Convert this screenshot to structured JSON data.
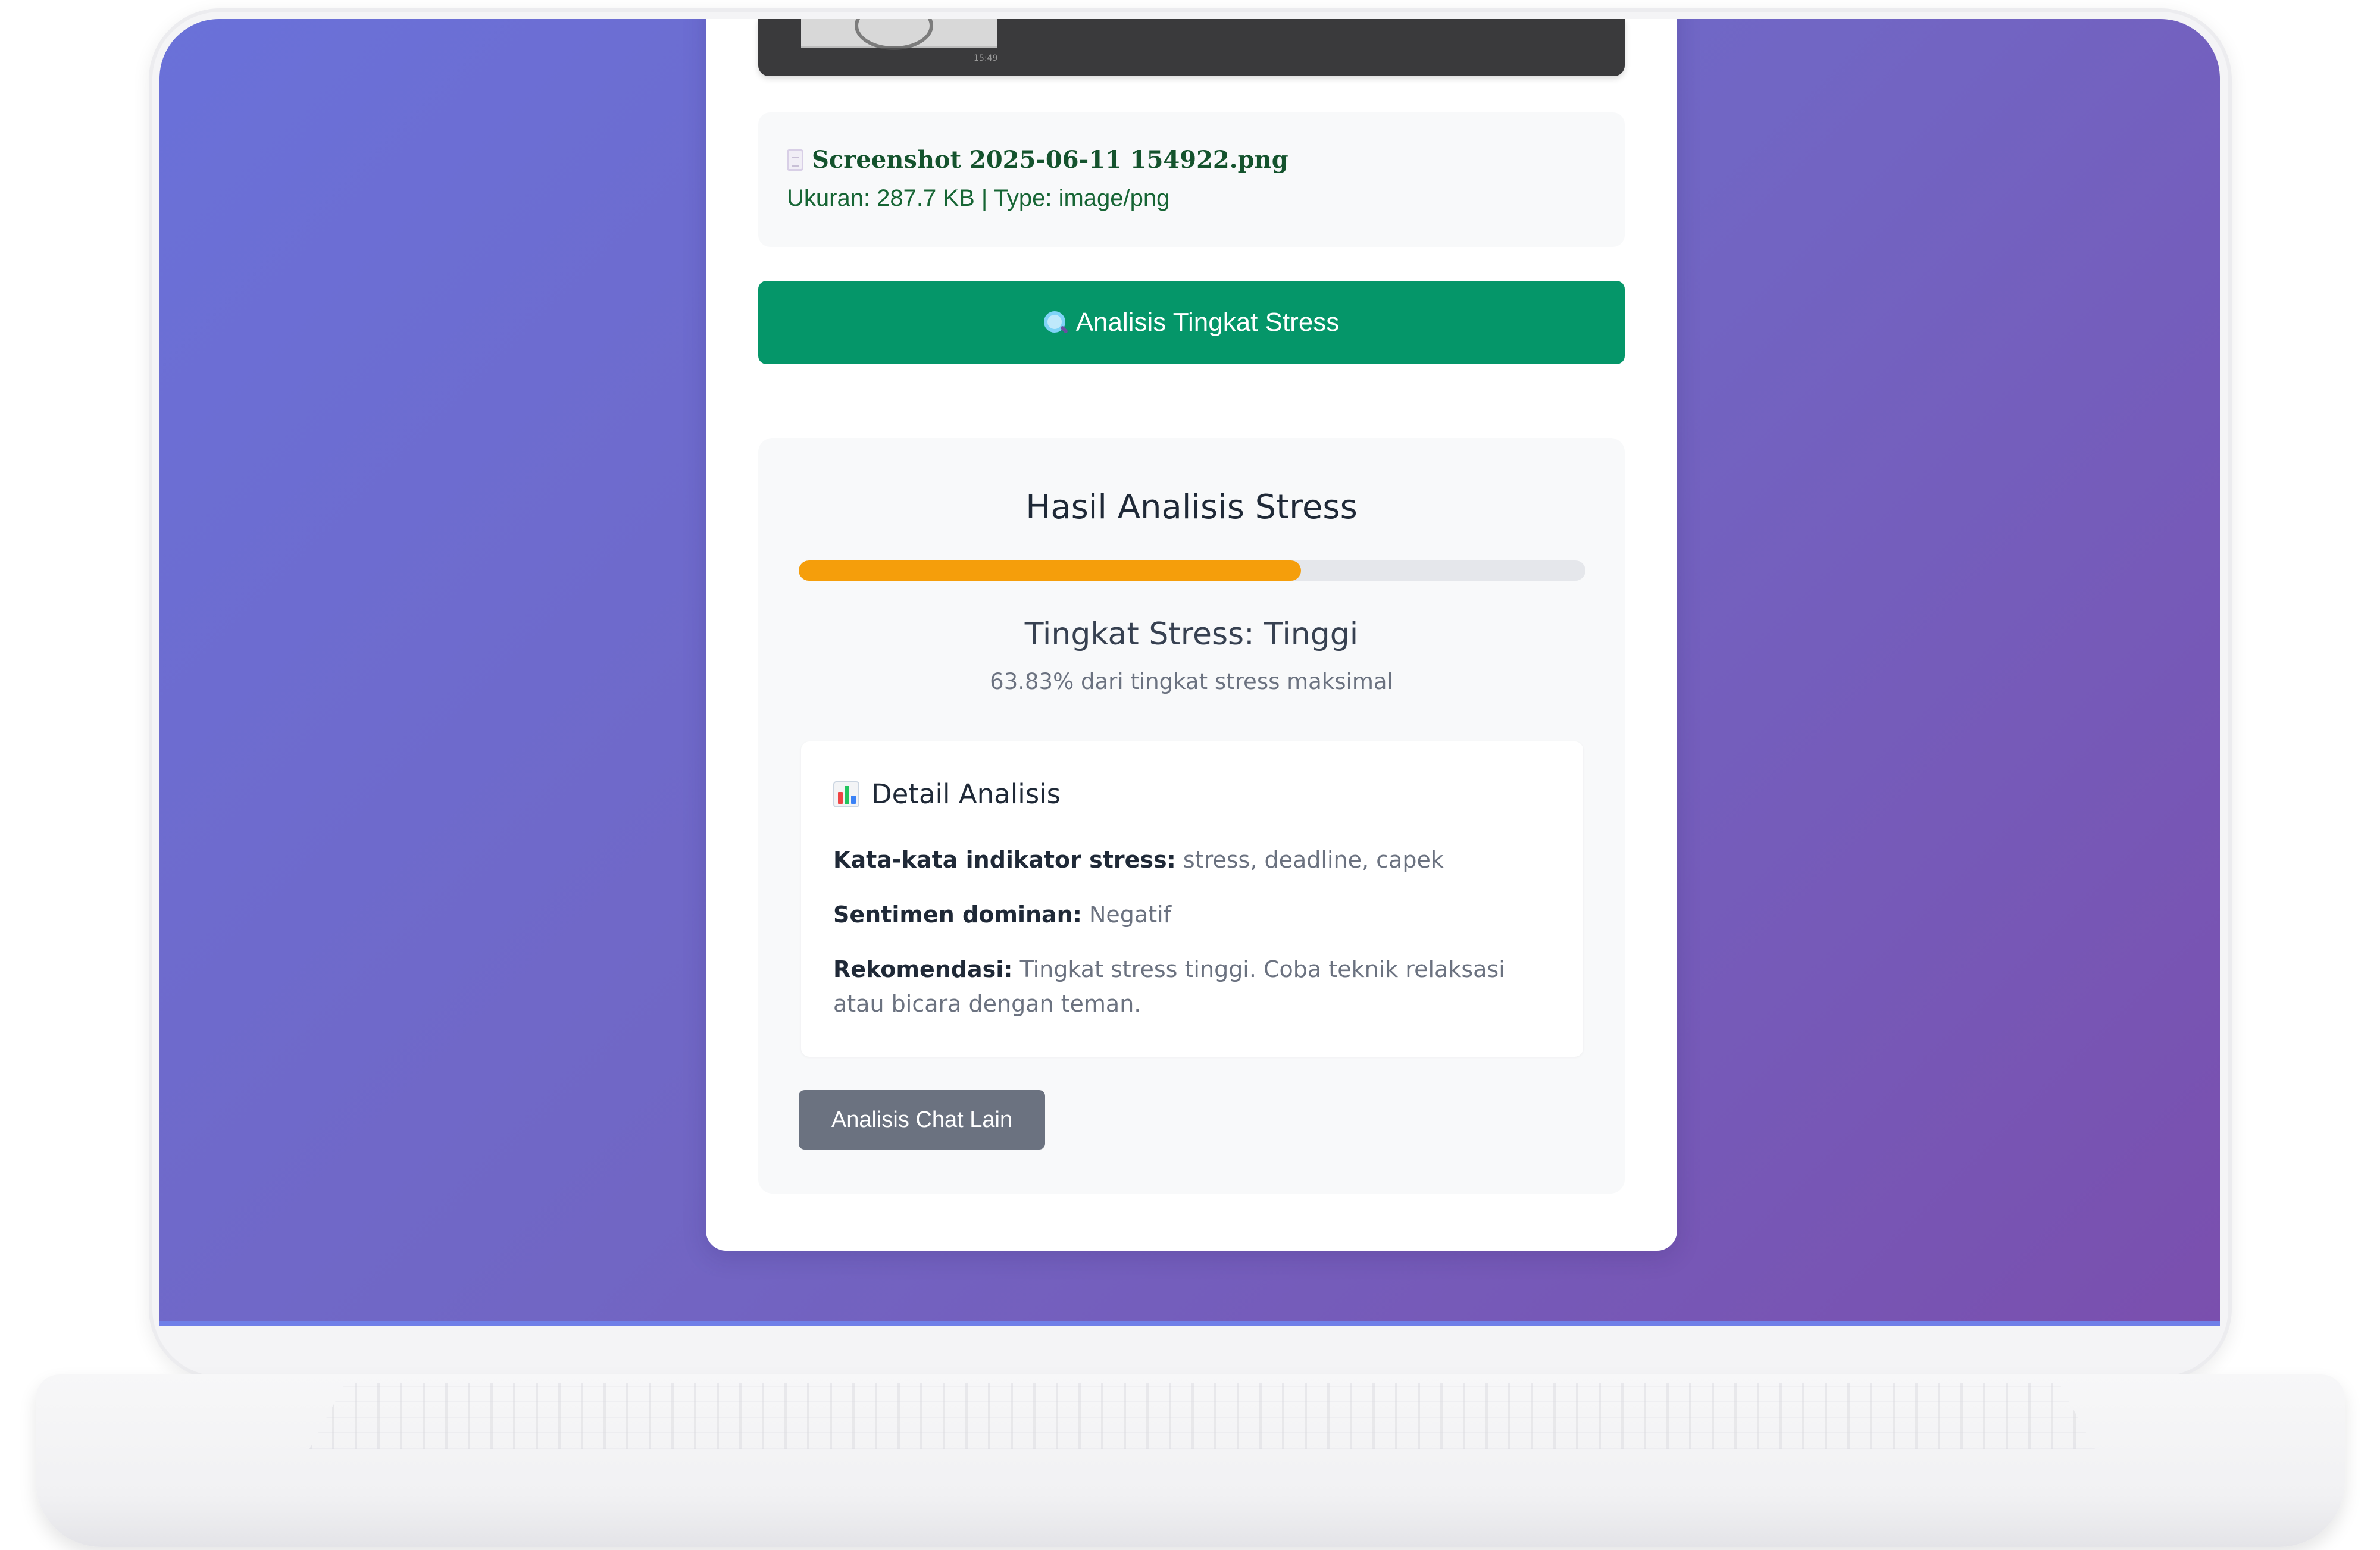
{
  "preview": {
    "timestamp": "15:49"
  },
  "file": {
    "name": "Screenshot 2025-06-11 154922.png",
    "meta": "Ukuran: 287.7 KB | Type: image/png"
  },
  "analyze_button": {
    "label": "Analisis Tingkat Stress",
    "color": "#059669",
    "icon": "search-icon"
  },
  "result": {
    "title": "Hasil Analisis Stress",
    "stress_fraction": 0.6383,
    "bar_color": "#f59e0b",
    "level_text": "Tingkat Stress: Tinggi",
    "percent_text": "63.83% dari tingkat stress maksimal"
  },
  "detail": {
    "heading": "Detail Analisis",
    "heading_icon": "bar-chart-icon",
    "rows": [
      {
        "label": "Kata-kata indikator stress:",
        "value": " stress, deadline, capek"
      },
      {
        "label": "Sentimen dominan:",
        "value": " Negatif"
      },
      {
        "label": "Rekomendasi:",
        "value": " Tingkat stress tinggi. Coba teknik relaksasi atau bicara dengan teman."
      }
    ]
  },
  "secondary_button": {
    "label": "Analisis Chat Lain",
    "color": "#6b7280"
  },
  "theme": {
    "background_gradient": [
      "#6a71d9",
      "#7a4fae"
    ]
  }
}
